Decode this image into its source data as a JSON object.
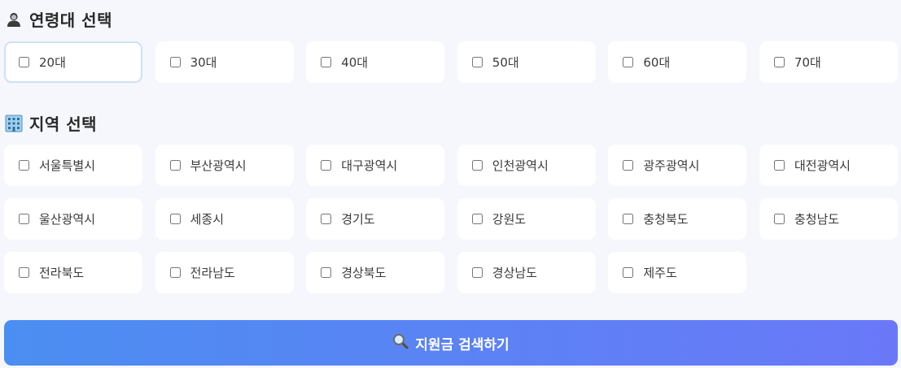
{
  "age_section": {
    "title": "연령대 선택",
    "icon": "person-silhouette-icon",
    "options": [
      {
        "label": "20대",
        "checked": false
      },
      {
        "label": "30대",
        "checked": false
      },
      {
        "label": "40대",
        "checked": false
      },
      {
        "label": "50대",
        "checked": false
      },
      {
        "label": "60대",
        "checked": false
      },
      {
        "label": "70대",
        "checked": false
      }
    ]
  },
  "region_section": {
    "title": "지역 선택",
    "icon": "office-building-icon",
    "options": [
      {
        "label": "서울특별시",
        "checked": false
      },
      {
        "label": "부산광역시",
        "checked": false
      },
      {
        "label": "대구광역시",
        "checked": false
      },
      {
        "label": "인천광역시",
        "checked": false
      },
      {
        "label": "광주광역시",
        "checked": false
      },
      {
        "label": "대전광역시",
        "checked": false
      },
      {
        "label": "울산광역시",
        "checked": false
      },
      {
        "label": "세종시",
        "checked": false
      },
      {
        "label": "경기도",
        "checked": false
      },
      {
        "label": "강원도",
        "checked": false
      },
      {
        "label": "충청북도",
        "checked": false
      },
      {
        "label": "충청남도",
        "checked": false
      },
      {
        "label": "전라북도",
        "checked": false
      },
      {
        "label": "전라남도",
        "checked": false
      },
      {
        "label": "경상북도",
        "checked": false
      },
      {
        "label": "경상남도",
        "checked": false
      },
      {
        "label": "제주도",
        "checked": false
      }
    ]
  },
  "search_button": {
    "label": "지원금 검색하기",
    "icon": "magnifier-icon"
  },
  "colors": {
    "background": "#f5f7fc",
    "button_gradient_start": "#4b8ef1",
    "button_gradient_end": "#6a78f8",
    "focus_border": "#cfe0f6"
  }
}
